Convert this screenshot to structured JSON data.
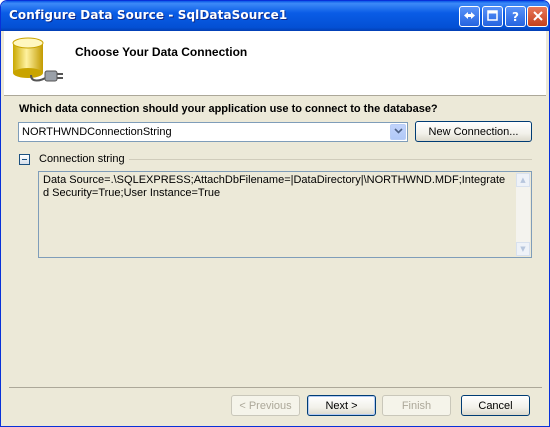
{
  "window": {
    "title": "Configure Data Source - SqlDataSource1",
    "controls": [
      "restore-icon",
      "maximize-icon",
      "help-icon",
      "close-icon"
    ]
  },
  "header": {
    "title": "Choose Your Data Connection",
    "icon": "database-plug-icon"
  },
  "connection": {
    "question": "Which data connection should your application use to connect to the database?",
    "selected": "NORTHWNDConnectionString",
    "new_connection_label": "New Connection..."
  },
  "connection_string": {
    "label": "Connection string",
    "value": "Data Source=.\\SQLEXPRESS;AttachDbFilename=|DataDirectory|\\NORTHWND.MDF;Integrated Security=True;User Instance=True"
  },
  "footer": {
    "previous_label": "< Previous",
    "next_label": "Next >",
    "finish_label": "Finish",
    "cancel_label": "Cancel"
  },
  "colors": {
    "titlebar": "#0a5ce6",
    "dialog_bg": "#ece9d8",
    "border": "#7f9db9"
  }
}
